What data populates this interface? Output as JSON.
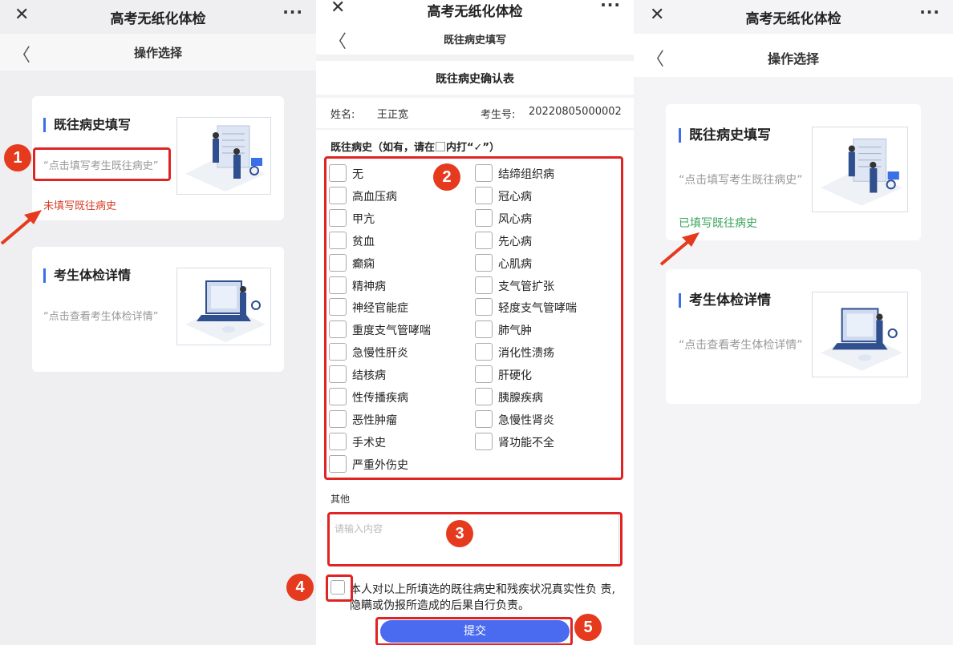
{
  "app_title": "高考无纸化体检",
  "panel1": {
    "nav_title": "操作选择",
    "card1": {
      "heading": "既往病史填写",
      "hint": "“点击填写考生既往病史”",
      "status": "未填写既往病史",
      "status_color": "#d9412c"
    },
    "card2": {
      "heading": "考生体检详情",
      "hint": "“点击查看考生体检详情”"
    }
  },
  "panel2": {
    "nav_title": "既往病史填写",
    "form_title": "既往病史确认表",
    "name_label": "姓名:",
    "name_value": "王正宽",
    "exam_no_label": "考生号:",
    "exam_no_value": "20220805000002",
    "history_label_pre": "既往病史（如有，请在",
    "history_label_post": "内打“✓”）",
    "options_left": [
      "无",
      "高血压病",
      "甲亢",
      "贫血",
      "癫痫",
      "精神病",
      "神经官能症",
      "重度支气管哮喘",
      "急慢性肝炎",
      "结核病",
      "性传播疾病",
      "恶性肿瘤",
      "手术史",
      "严重外伤史"
    ],
    "options_right": [
      "结缔组织病",
      "冠心病",
      "风心病",
      "先心病",
      "心肌病",
      "支气管扩张",
      "轻度支气管哮喘",
      "肺气肿",
      "消化性溃疡",
      "肝硬化",
      "胰腺疾病",
      "急慢性肾炎",
      "肾功能不全"
    ],
    "other_label": "其他",
    "other_placeholder": "请输入内容",
    "agreement": "本人对以上所填选的既往病史和残疾状况真实性负 责,隐瞒或伪报所造成的后果自行负责。",
    "submit_label": "提交"
  },
  "panel3": {
    "nav_title": "操作选择",
    "card1": {
      "heading": "既往病史填写",
      "hint": "“点击填写考生既往病史”",
      "status": "已填写既往病史",
      "status_color": "#3aa55a"
    },
    "card2": {
      "heading": "考生体检详情",
      "hint": "“点击查看考生体检详情”"
    }
  },
  "annotations": [
    "1",
    "2",
    "3",
    "4",
    "5"
  ],
  "icons": {
    "close": "close-icon",
    "more": "more-icon",
    "back": "back-chevron-icon"
  },
  "colors": {
    "accent": "#3a6fe8",
    "annotation_red": "#e02424",
    "submit_blue": "#4a6bf0"
  }
}
